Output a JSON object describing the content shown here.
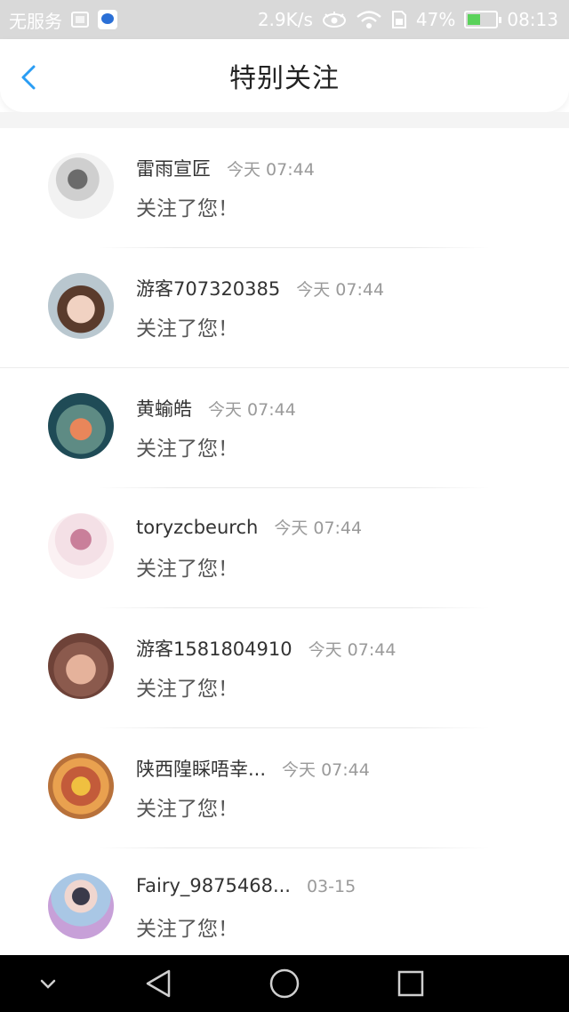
{
  "status_bar": {
    "carrier": "无服务",
    "speed": "2.9K/s",
    "battery": "47%",
    "battery_fraction": 0.47,
    "time": "08:13",
    "icons": [
      "image-icon",
      "app-notification-icon",
      "eye-icon",
      "wifi-icon",
      "sim-icon",
      "battery-icon"
    ]
  },
  "header": {
    "title": "特别关注",
    "back_icon": "back-chevron-icon"
  },
  "colors": {
    "accent": "#2a9df4",
    "name_text": "#333333",
    "time_text": "#9a9a9a",
    "status_bar_bg": "#d9d9d9"
  },
  "items": [
    {
      "name": "雷雨宣匠",
      "time": "今天 07:44",
      "message": "关注了您！"
    },
    {
      "name": "游客707320385",
      "time": "今天 07:44",
      "message": "关注了您！"
    },
    {
      "name": "黄蝓皓",
      "time": "今天 07:44",
      "message": "关注了您！"
    },
    {
      "name": "toryzcbeurch",
      "time": "今天 07:44",
      "message": "关注了您！"
    },
    {
      "name": "游客1581804910",
      "time": "今天 07:44",
      "message": "关注了您！"
    },
    {
      "name": "陕西隍睬唔幸...",
      "time": "今天 07:44",
      "message": "关注了您！"
    },
    {
      "name": "Fairy_9875468...",
      "time": "03-15",
      "message": "关注了您！"
    }
  ],
  "nav_bar": {
    "icons": [
      "chevron-down-icon",
      "back-triangle-icon",
      "home-circle-icon",
      "recents-square-icon"
    ]
  }
}
